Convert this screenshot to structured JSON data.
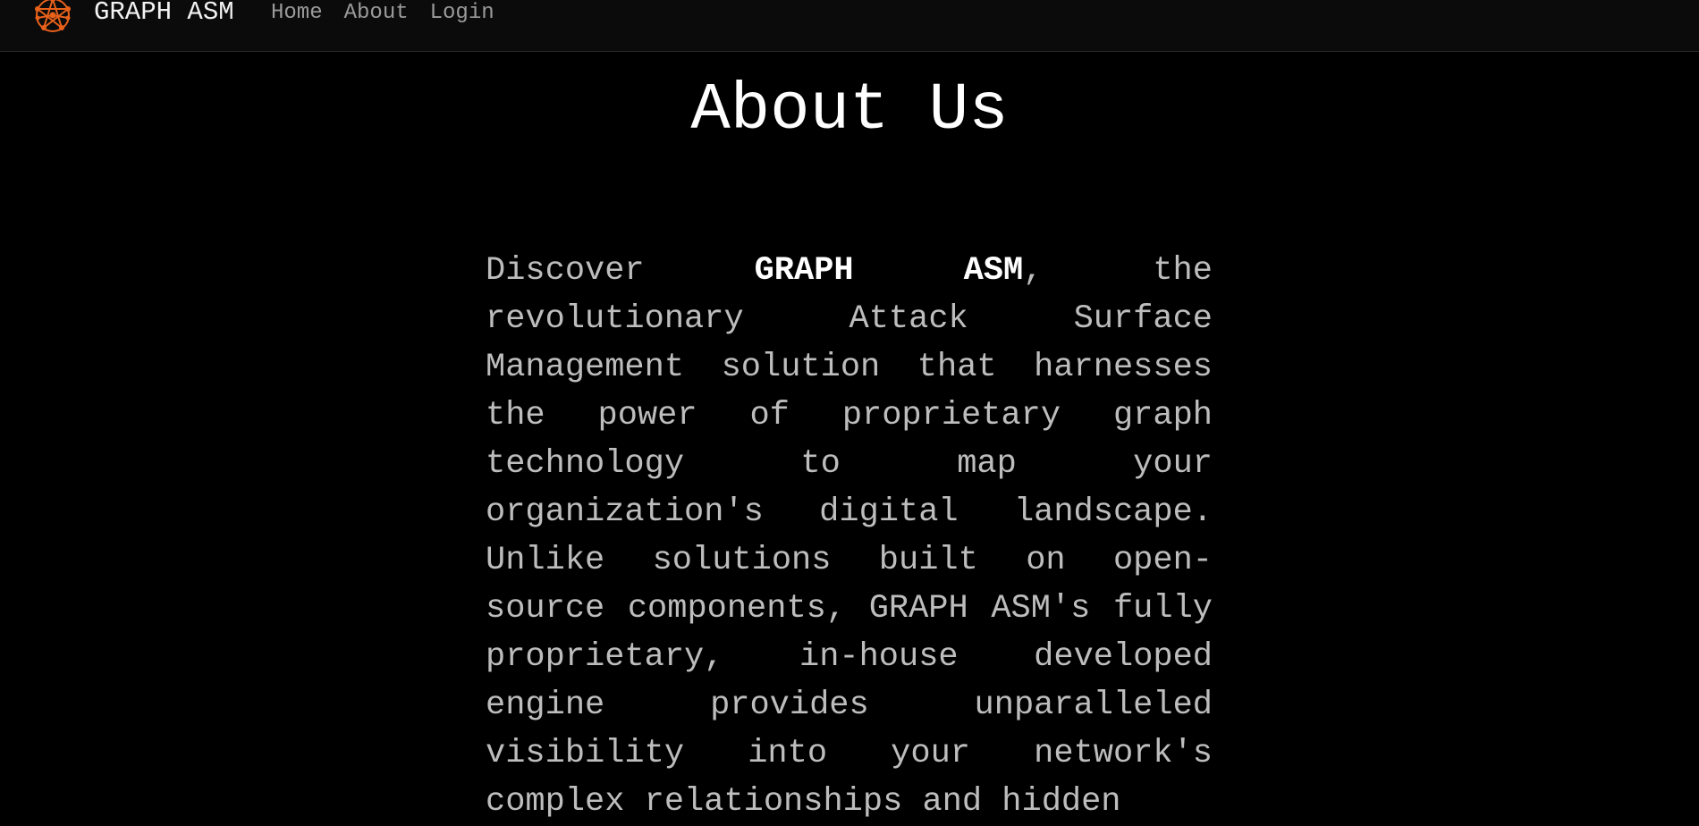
{
  "header": {
    "brand": "GRAPH ASM",
    "logo_icon": "graph-network-logo-icon",
    "nav": [
      {
        "label": "Home"
      },
      {
        "label": "About"
      },
      {
        "label": "Login"
      }
    ]
  },
  "main": {
    "title": "About Us",
    "intro_lead": "Discover ",
    "intro_brand": "GRAPH ASM",
    "intro_body": ", the revolutionary Attack Surface Management solution that harnesses the power of proprietary graph technology to map your organization's digital landscape. Unlike solutions built on open-source components, GRAPH ASM's fully proprietary, in-house developed engine provides unparalleled visibility into your network's complex relationships and hidden"
  },
  "colors": {
    "background": "#000000",
    "navbar": "#0b0b0b",
    "accent": "#e8611a",
    "text": "#bdbdbd",
    "nav_text": "#9a9a9a"
  }
}
